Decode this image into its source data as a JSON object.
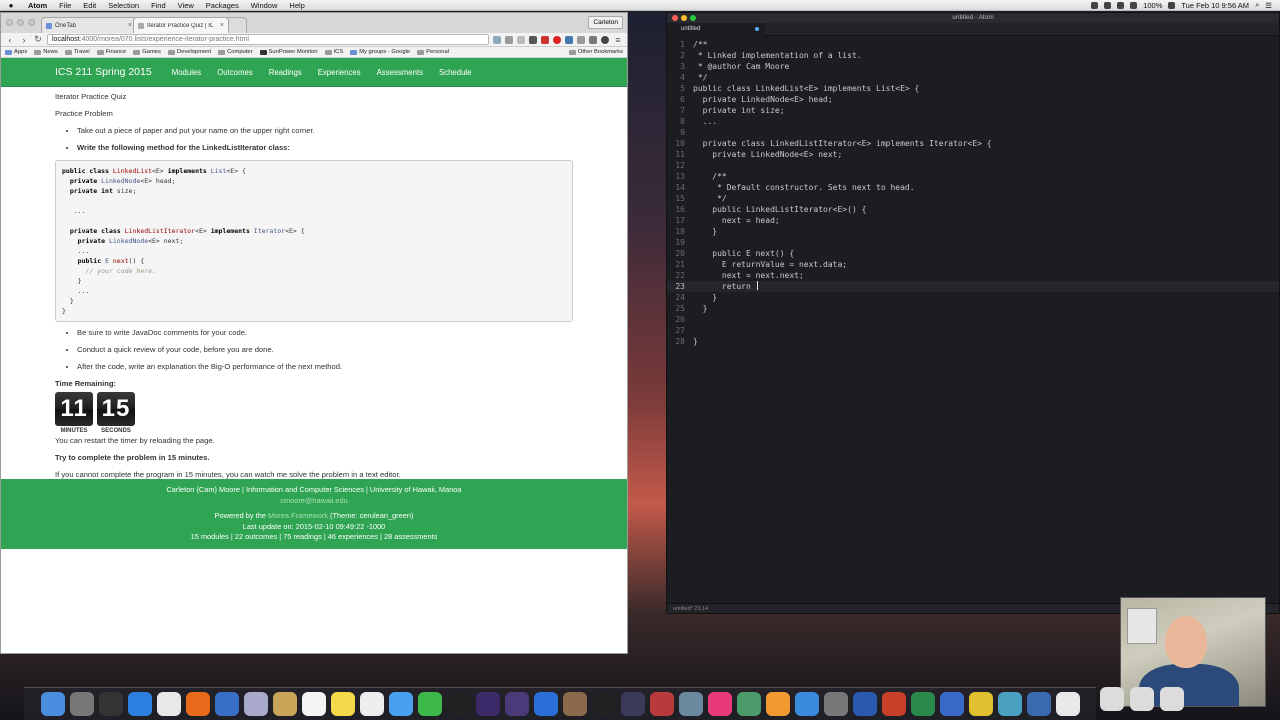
{
  "menubar": {
    "app": "Atom",
    "items": [
      "File",
      "Edit",
      "Selection",
      "Find",
      "View",
      "Packages",
      "Window",
      "Help"
    ],
    "battery": "100%",
    "clock": "Tue Feb 10  9:56 AM"
  },
  "chrome": {
    "tabs": [
      {
        "label": "OneTab"
      },
      {
        "label": "Iterator Practice Quiz | ICS"
      }
    ],
    "user_button": "Carleton",
    "url_host": "localhost",
    "url_path": ":4000/morea/070.lists/experience-iterator-practice.html",
    "bookmarks": [
      "Apps",
      "News",
      "Travel",
      "Finance",
      "Games",
      "Development",
      "Computer",
      "SunPower Monitori",
      "ICS",
      "My groups - Google",
      "Personal"
    ],
    "other_bookmarks": "Other Bookmarks"
  },
  "site": {
    "brand": "ICS 211 Spring 2015",
    "nav": [
      "Modules",
      "Outcomes",
      "Readings",
      "Experiences",
      "Assessments",
      "Schedule"
    ],
    "heading": "Iterator Practice Quiz",
    "subheading": "Practice Problem",
    "bullet1": "Take out a piece of paper and put your name on the upper right corner.",
    "bullet2": "Write the following method for the LinkedListIterator class:",
    "bullets_after": [
      "Be sure to write JavaDoc comments for your code.",
      "Conduct a quick review of your code, before you are done.",
      "After the code, write an explanation the Big-O performance of the next method."
    ],
    "time_remaining_label": "Time Remaining:",
    "timer_minutes": "11",
    "timer_seconds": "15",
    "minutes_label": "MINUTES",
    "seconds_label": "SECONDS",
    "restart_note": "You can restart the timer by reloading the page.",
    "try_note": "Try to complete the problem in 15 minutes.",
    "fallback_note": "If you cannot complete the program in 15 minutes, you can watch me solve the problem in a text editor."
  },
  "footer": {
    "line1": "Carleton (Cam) Moore | Information and Computer Sciences | University of Hawaii, Manoa",
    "email": "cmoore@hawaii.edu",
    "powered_prefix": "Powered by the ",
    "powered_link": "Morea Framework",
    "powered_suffix": " (Theme: cerulean_green)",
    "last_update": "Last update on: 2015-02-10 09:49:22 -1000",
    "stats": "15 modules | 22 outcomes | 75 readings | 46 experiences | 28 assessments"
  },
  "atom": {
    "title": "untitled - Atom",
    "tab_label": "untitled",
    "status": "untitled*   23,14",
    "current_line": 23,
    "lines": [
      "/**",
      " * Linked implementation of a list.",
      " * @author Cam Moore",
      " */",
      "public class LinkedList<E> implements List<E> {",
      "  private LinkedNode<E> head;",
      "  private int size;",
      "  ...",
      "",
      "  private class LinkedListIterator<E> implements Iterator<E> {",
      "    private LinkedNode<E> next;",
      "",
      "    /**",
      "     * Default constructor. Sets next to head.",
      "     */",
      "    public LinkedListIterator<E>() {",
      "      next = head;",
      "    }",
      "",
      "    public E next() {",
      "      E returnValue = next.data;",
      "      next = next.next;",
      "      return ",
      "    }",
      "  }",
      "",
      "",
      "}"
    ]
  },
  "dock_apps": [
    "finder-icon",
    "launchpad-icon",
    "activity-icon",
    "safari-icon",
    "chrome-icon",
    "firefox-icon",
    "thunderbird-icon",
    "preview-icon",
    "archive-icon",
    "calendar-icon",
    "notes-icon",
    "textedit-icon",
    "messages-icon",
    "facetime-icon",
    "terminal-icon",
    "eclipse-icon",
    "eclipse2-icon",
    "intellij-icon",
    "gimp-icon",
    "github-icon",
    "screenflow-icon",
    "photobooth-icon",
    "capture-icon",
    "itunes-icon",
    "atom-icon",
    "ibooks-icon",
    "appstore-icon",
    "sysprefs-icon",
    "word-icon",
    "powerpoint-icon",
    "excel-icon",
    "outlook-icon",
    "growl-icon",
    "network-icon",
    "xcode-icon",
    "phone-icon"
  ]
}
